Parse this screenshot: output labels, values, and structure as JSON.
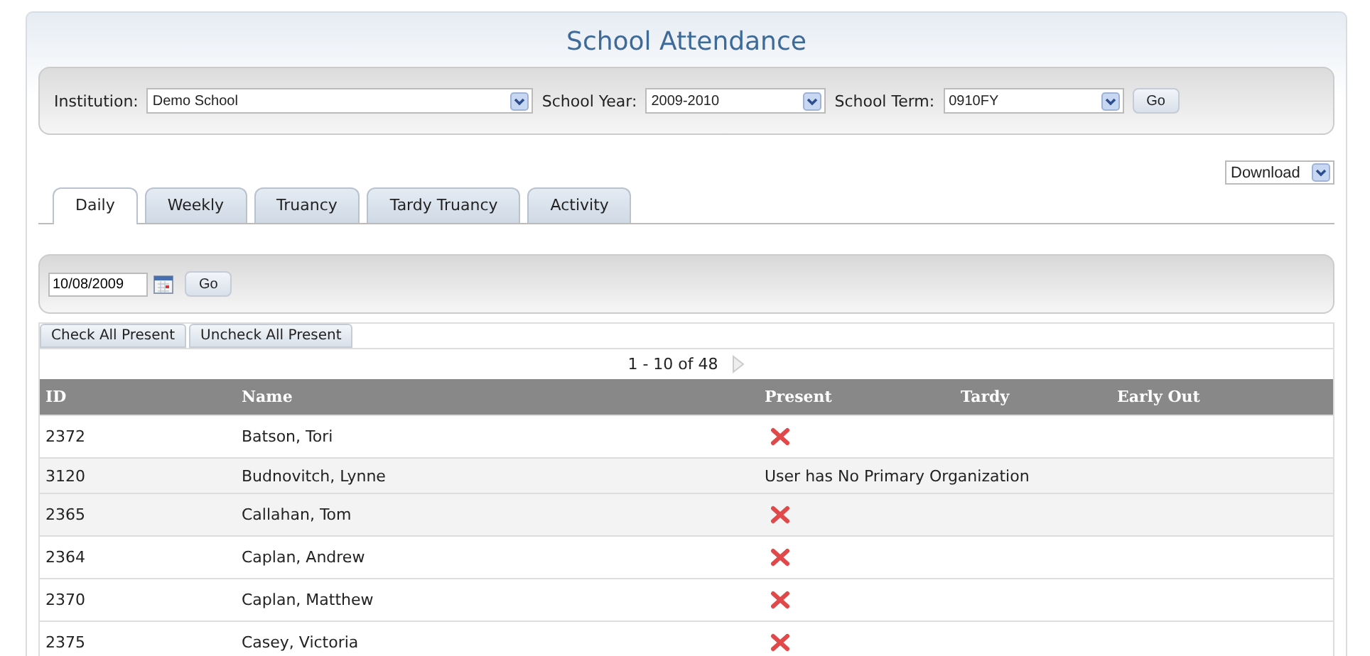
{
  "title": "School Attendance",
  "filters": [
    {
      "label": "Institution:",
      "value": "Demo School"
    },
    {
      "label": "School Year:",
      "value": "2009-2010"
    },
    {
      "label": "School Term:",
      "value": "0910FY"
    }
  ],
  "filter_button": "Go",
  "download": "Download",
  "tabs": [
    {
      "label": "Daily",
      "selected": true
    },
    {
      "label": "Weekly",
      "selected": false
    },
    {
      "label": "Truancy",
      "selected": false
    },
    {
      "label": "Tardy Truancy",
      "selected": false
    },
    {
      "label": "Activity",
      "selected": false
    }
  ],
  "date_field": {
    "value": "10/08/2009"
  },
  "date_button": "Go",
  "actions": [
    "Check All Present",
    "Uncheck All Present"
  ],
  "pager": "1 - 10 of 48",
  "table": {
    "columns": [
      "ID",
      "Name",
      "Present",
      "Tardy",
      "Early Out"
    ],
    "rows": [
      {
        "id": "2372",
        "name": "Batson, Tori",
        "present": {
          "kind": "absent"
        }
      },
      {
        "id": "3120",
        "name": "Budnovitch, Lynne",
        "present": {
          "kind": "note",
          "text": "User has No Primary Organization"
        }
      },
      {
        "id": "2365",
        "name": "Callahan, Tom",
        "present": {
          "kind": "absent"
        }
      },
      {
        "id": "2364",
        "name": "Caplan, Andrew",
        "present": {
          "kind": "absent"
        }
      },
      {
        "id": "2370",
        "name": "Caplan, Matthew",
        "present": {
          "kind": "absent"
        }
      },
      {
        "id": "2375",
        "name": "Casey, Victoria",
        "present": {
          "kind": "absent"
        }
      }
    ]
  }
}
